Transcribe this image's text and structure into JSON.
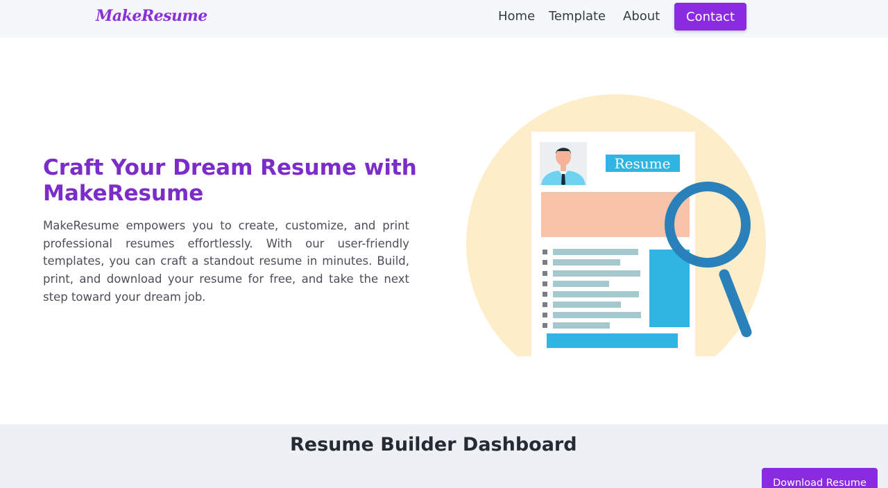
{
  "navbar": {
    "brand": "MakeResume",
    "links": [
      "Home",
      "Template",
      "About"
    ],
    "contact_label": "Contact"
  },
  "hero": {
    "title": "Craft Your Dream Resume with MakeResume",
    "description": "MakeResume empowers you to create, customize, and print professional resumes effortlessly. With our user-friendly templates, you can craft a standout resume in minutes. Build, print, and download your resume for free, and take the next step toward your dream job."
  },
  "illustration": {
    "resume_label": "Resume",
    "colors": {
      "background_circle": "#fdedc9",
      "header_bar": "#f9c3aa",
      "accent_blue": "#2fb5e2",
      "text_lines": "#a5c8cf",
      "magnifier": "#2a80b9"
    }
  },
  "dashboard": {
    "title": "Resume Builder Dashboard",
    "download_label": "Download Resume"
  },
  "theme": {
    "brand_purple": "#8a2be2",
    "title_purple": "#7b2cc9"
  }
}
